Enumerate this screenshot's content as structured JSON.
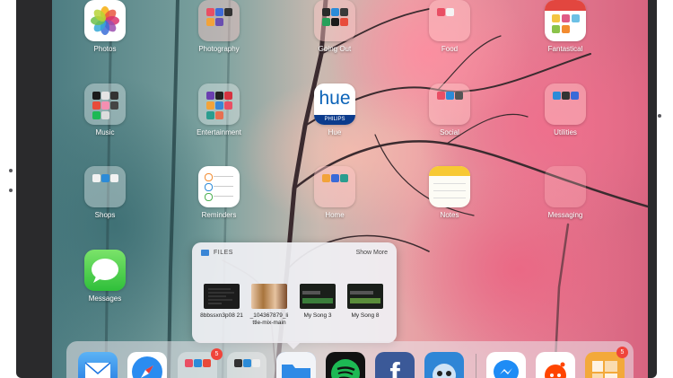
{
  "apps": {
    "photos": "Photos",
    "photography": "Photography",
    "going_out": "Going Out",
    "food": "Food",
    "fantastical": "Fantastical",
    "music": "Music",
    "entertainment": "Entertainment",
    "hue": "Hue",
    "hue_logo": "hue",
    "hue_brand": "PHILIPS",
    "social": "Social",
    "utilities": "Utilities",
    "shops": "Shops",
    "reminders": "Reminders",
    "home": "Home",
    "notes": "Notes",
    "messaging": "Messaging",
    "messages": "Messages"
  },
  "files_popup": {
    "title": "FILES",
    "show_more": "Show More",
    "items": [
      {
        "name": "8bbssxn3p08 21"
      },
      {
        "name": "_104367879_li ttle-mix-main"
      },
      {
        "name": "My Song 3"
      },
      {
        "name": "My Song 8"
      }
    ]
  },
  "dock": {
    "badges": {
      "folder1": "5",
      "right_app": "5"
    },
    "facebook_letter": "f"
  },
  "colors": {
    "folder_blue": "#3a86d6",
    "badge_red": "#f0443a",
    "spotify_green": "#1db954",
    "facebook_blue": "#3b5998"
  }
}
